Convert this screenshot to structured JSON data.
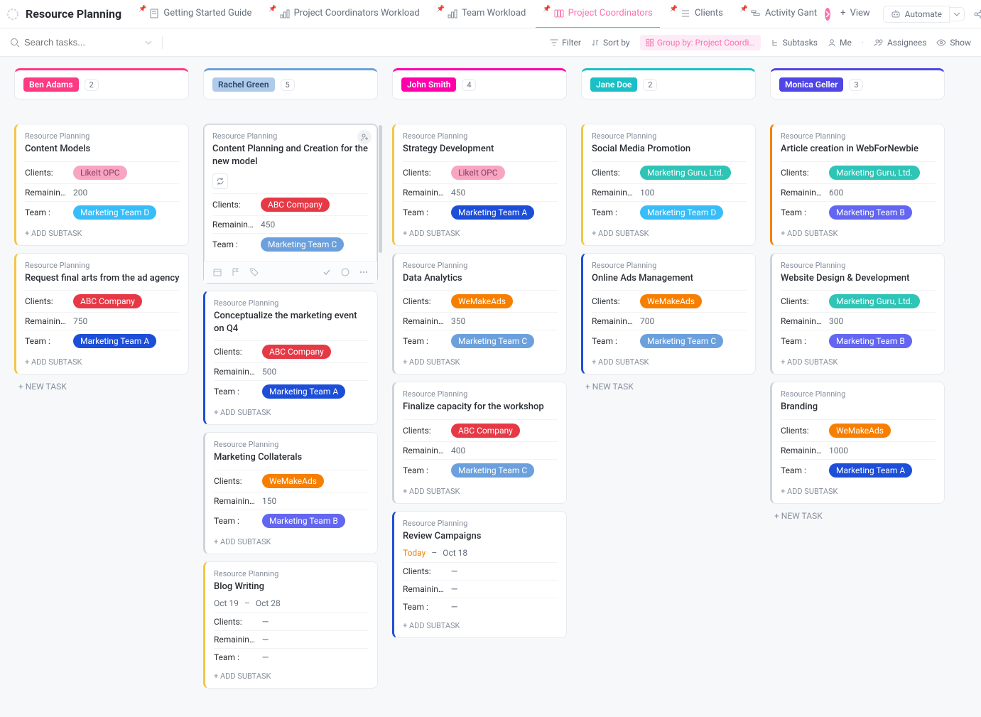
{
  "pageTitle": "Resource Planning",
  "tabs": [
    {
      "label": "Getting Started Guide"
    },
    {
      "label": "Project Coordinators Workload"
    },
    {
      "label": "Team Workload"
    },
    {
      "label": "Project Coordinators",
      "active": true
    },
    {
      "label": "Clients"
    },
    {
      "label": "Activity Gant"
    }
  ],
  "addView": "View",
  "automate": "Automate",
  "search": {
    "placeholder": "Search tasks..."
  },
  "toolbar": {
    "filter": "Filter",
    "sort": "Sort by",
    "group": "Group by: Project Coordin...",
    "subtasks": "Subtasks",
    "me": "Me",
    "assignees": "Assignees",
    "show": "Show"
  },
  "labels": {
    "project": "Resource Planning",
    "clients": "Clients:",
    "remaining": "Remaining ...",
    "team": "Team :",
    "addSubtask": "+ ADD SUBTASK",
    "newTask": "+ NEW TASK",
    "today": "Today"
  },
  "lanes": [
    {
      "id": "ben",
      "name": "Ben Adams",
      "count": "2",
      "headColor": "#fd3a84",
      "chipBg": "#fd3a84",
      "chipFg": "#ffffff",
      "cards": [
        {
          "accent": "#f6c445",
          "title": "Content Models",
          "client": {
            "text": "LikeIt OPC",
            "cls": "LikeIt"
          },
          "remaining": "200",
          "team": {
            "text": "Marketing Team D",
            "cls": "TeamD"
          }
        },
        {
          "accent": "#f6c445",
          "title": "Request final arts from the ad agency",
          "client": {
            "text": "ABC Company",
            "cls": "ABC"
          },
          "remaining": "750",
          "team": {
            "text": "Marketing Team A",
            "cls": "TeamA"
          }
        }
      ],
      "newTask": true
    },
    {
      "id": "rachel",
      "name": "Rachel Green",
      "count": "5",
      "headColor": "#6ca0dc",
      "chipBg": "#aecbeb",
      "chipFg": "#2e4a6b",
      "scroll": true,
      "cards": [
        {
          "accent": "#cfd3da",
          "title": "Content Planning and Creation for the new model",
          "selected": true,
          "avatar": true,
          "repeat": true,
          "client": {
            "text": "ABC Company",
            "cls": "ABC"
          },
          "remaining": "450",
          "team": {
            "text": "Marketing Team C",
            "cls": "TeamC"
          },
          "actions": true
        },
        {
          "accent": "#1d4ed8",
          "title": "Conceptualize the marketing event on Q4",
          "client": {
            "text": "ABC Company",
            "cls": "ABC"
          },
          "remaining": "500",
          "team": {
            "text": "Marketing Team A",
            "cls": "TeamA"
          }
        },
        {
          "accent": "#cfd3da",
          "title": "Marketing Collaterals",
          "client": {
            "text": "WeMakeAds",
            "cls": "WeMakeAds"
          },
          "remaining": "150",
          "team": {
            "text": "Marketing Team B",
            "cls": "TeamB"
          }
        },
        {
          "accent": "#f6c445",
          "title": "Blog Writing",
          "dateStart": "Oct 19",
          "dateEnd": "Oct 28",
          "clientEmpty": true,
          "remainingEmpty": true,
          "teamEmpty": true
        }
      ]
    },
    {
      "id": "john",
      "name": "John Smith",
      "count": "4",
      "headColor": "#ff00aa",
      "chipBg": "#ff00aa",
      "chipFg": "#ffffff",
      "cards": [
        {
          "accent": "#f6c445",
          "title": "Strategy Development",
          "client": {
            "text": "LikeIt OPC",
            "cls": "LikeIt"
          },
          "remaining": "450",
          "team": {
            "text": "Marketing Team A",
            "cls": "TeamA"
          }
        },
        {
          "accent": "#cfd3da",
          "title": "Data Analytics",
          "client": {
            "text": "WeMakeAds",
            "cls": "WeMakeAds"
          },
          "remaining": "350",
          "team": {
            "text": "Marketing Team C",
            "cls": "TeamC"
          }
        },
        {
          "accent": "#cfd3da",
          "title": "Finalize capacity for the workshop",
          "client": {
            "text": "ABC Company",
            "cls": "ABC"
          },
          "remaining": "400",
          "team": {
            "text": "Marketing Team C",
            "cls": "TeamC"
          }
        },
        {
          "accent": "#1d4ed8",
          "title": "Review Campaigns",
          "dateToday": true,
          "dateEnd": "Oct 18",
          "clientEmpty": true,
          "remainingEmpty": true,
          "teamEmpty": true
        }
      ]
    },
    {
      "id": "jane",
      "name": "Jane Doe",
      "count": "2",
      "headColor": "#1ac0c6",
      "chipBg": "#1ac0c6",
      "chipFg": "#ffffff",
      "cards": [
        {
          "accent": "#f6c445",
          "title": "Social Media Promotion",
          "client": {
            "text": "Marketing Guru, Ltd.",
            "cls": "MarketingGuru"
          },
          "remaining": "100",
          "team": {
            "text": "Marketing Team D",
            "cls": "TeamD"
          }
        },
        {
          "accent": "#1d4ed8",
          "title": "Online Ads Management",
          "client": {
            "text": "WeMakeAds",
            "cls": "WeMakeAds"
          },
          "remaining": "700",
          "team": {
            "text": "Marketing Team C",
            "cls": "TeamC"
          }
        }
      ],
      "newTask": true
    },
    {
      "id": "monica",
      "name": "Monica Geller",
      "count": "3",
      "headColor": "#4f46e5",
      "chipBg": "#4f46e5",
      "chipFg": "#ffffff",
      "cards": [
        {
          "accent": "#f77f00",
          "title": "Article creation in WebForNewbie",
          "client": {
            "text": "Marketing Guru, Ltd.",
            "cls": "MarketingGuru"
          },
          "remaining": "600",
          "team": {
            "text": "Marketing Team B",
            "cls": "TeamB"
          }
        },
        {
          "accent": "#cfd3da",
          "title": "Website Design & Development",
          "client": {
            "text": "Marketing Guru, Ltd.",
            "cls": "MarketingGuru"
          },
          "remaining": "300",
          "team": {
            "text": "Marketing Team B",
            "cls": "TeamB"
          }
        },
        {
          "accent": "#cfd3da",
          "title": "Branding",
          "client": {
            "text": "WeMakeAds",
            "cls": "WeMakeAds"
          },
          "remaining": "1000",
          "team": {
            "text": "Marketing Team A",
            "cls": "TeamA"
          }
        }
      ],
      "newTask": true
    }
  ]
}
